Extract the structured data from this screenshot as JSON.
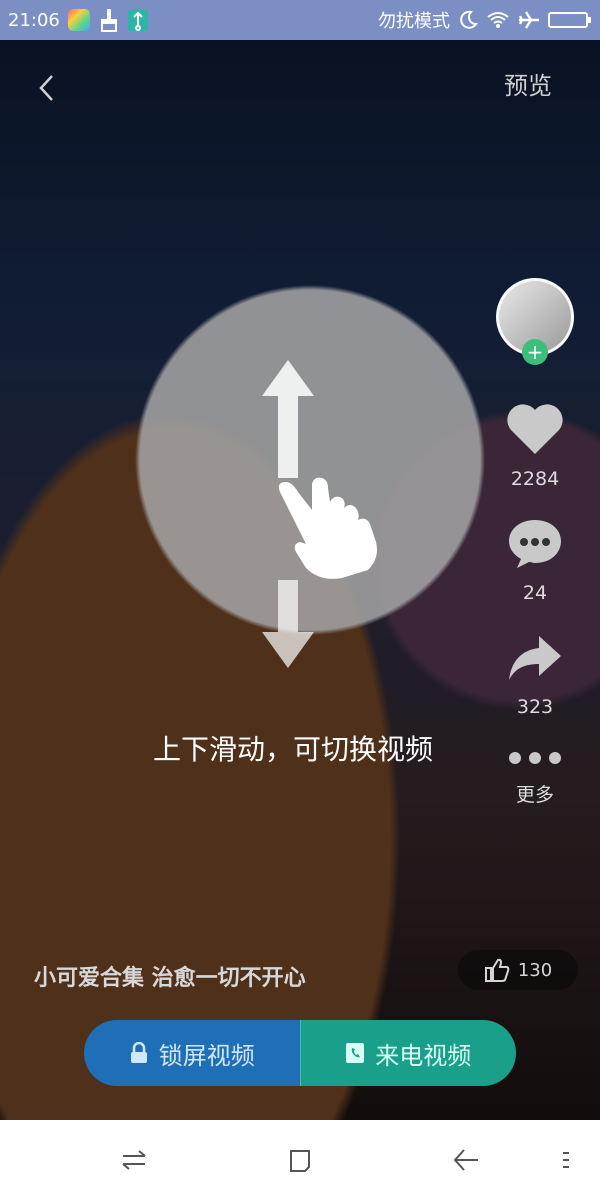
{
  "status_bar": {
    "time": "21:06",
    "dnd_label": "勿扰模式",
    "icons": [
      "app-icon",
      "broom-icon",
      "usb-icon",
      "moon-icon",
      "wifi-icon",
      "airplane-icon",
      "battery-icon"
    ]
  },
  "header": {
    "back_icon": "chevron-left-icon",
    "preview_label": "预览"
  },
  "right_rail": {
    "like_count": "2284",
    "comment_count": "24",
    "share_count": "323",
    "more_label": "更多"
  },
  "overlay": {
    "swipe_hint": "上下滑动，可切换视频"
  },
  "video": {
    "title": "小可爱合集 治愈一切不开心",
    "likes": "130"
  },
  "actions": {
    "lockscreen_label": "锁屏视频",
    "call_label": "来电视频"
  },
  "nav_bar": {
    "icons": [
      "switch-icon",
      "square-icon",
      "back-arrow-icon",
      "menu-icon"
    ]
  },
  "colors": {
    "status_bar": "#7b8fc5",
    "lock_button": "#1f6fb6",
    "call_button": "#1aa08a",
    "avatar_add": "#3bbf7b"
  }
}
